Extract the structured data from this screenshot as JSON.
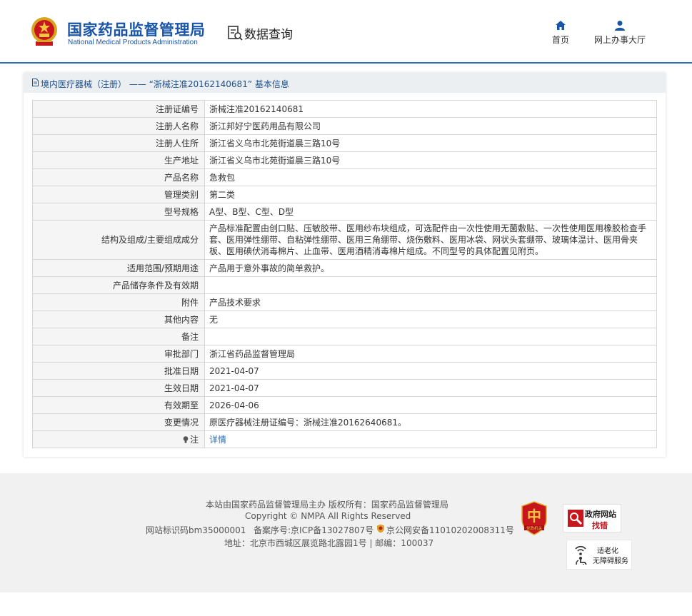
{
  "header": {
    "org_name_cn": "国家药品监督管理局",
    "org_name_en": "National Medical Products Administration",
    "section_title": "数据查询",
    "nav": [
      {
        "label": "首页",
        "icon": "home-icon"
      },
      {
        "label": "网上办事大厅",
        "icon": "user-icon"
      }
    ]
  },
  "panel": {
    "title": "境内医疗器械（注册） —— “浙械注准20162140681” 基本信息",
    "rows": [
      {
        "label": "注册证编号",
        "value": "浙械注准20162140681"
      },
      {
        "label": "注册人名称",
        "value": "浙江邦好宁医药用品有限公司"
      },
      {
        "label": "注册人住所",
        "value": "浙江省义乌市北苑街道晨三路10号"
      },
      {
        "label": "生产地址",
        "value": "浙江省义乌市北苑街道晨三路10号"
      },
      {
        "label": "产品名称",
        "value": "急救包"
      },
      {
        "label": "管理类别",
        "value": "第二类"
      },
      {
        "label": "型号规格",
        "value": "A型、B型、C型、D型"
      },
      {
        "label": "结构及组成/主要组成成分",
        "value": "产品标准配置由创口贴、压敏胶带、医用纱布块组成，可选配件由一次性使用无菌敷贴、一次性使用医用橡胶检查手套、医用弹性绷带、自粘弹性绷带、医用三角绷带、烧伤敷料、医用冰袋、网状头套绷带、玻璃体温计、医用骨夹板、医用碘伏消毒棉片、止血带、医用酒精消毒棉片组成。不同型号的具体配置见附页。"
      },
      {
        "label": "适用范围/预期用途",
        "value": "产品用于意外事故的简单救护。"
      },
      {
        "label": "产品储存条件及有效期",
        "value": ""
      },
      {
        "label": "附件",
        "value": "产品技术要求"
      },
      {
        "label": "其他内容",
        "value": "无"
      },
      {
        "label": "备注",
        "value": ""
      },
      {
        "label": "审批部门",
        "value": "浙江省药品监督管理局"
      },
      {
        "label": "批准日期",
        "value": "2021-04-07"
      },
      {
        "label": "生效日期",
        "value": "2021-04-07"
      },
      {
        "label": "有效期至",
        "value": "2026-04-06"
      },
      {
        "label": "变更情况",
        "value": "原医疗器械注册证编号：浙械注准20162640681。"
      }
    ],
    "note_label": "注",
    "note_link": "详情"
  },
  "footer": {
    "line1": "本站由国家药品监督管理局主办 版权所有：国家药品监督管理局",
    "line2": "Copyright © NMPA All Rights Reserved",
    "site_id": "网站标识码bm35000001",
    "icp": "备案序号:京ICP备13027807号",
    "police": "京公网安备11010202008311号",
    "address": "地址：北京市西城区展览路北露园1号 | 邮编：100037",
    "badge_text": "党政机关",
    "gov_find_line1": "政府网站",
    "gov_find_line2": "找错",
    "access_line1": "适老化",
    "access_line2": "无障碍服务"
  },
  "colors": {
    "brand_blue": "#1a56a8",
    "accent_line": "#2a6fb7",
    "link": "#2a6fb7",
    "label_bg": "#f5f5f5"
  }
}
